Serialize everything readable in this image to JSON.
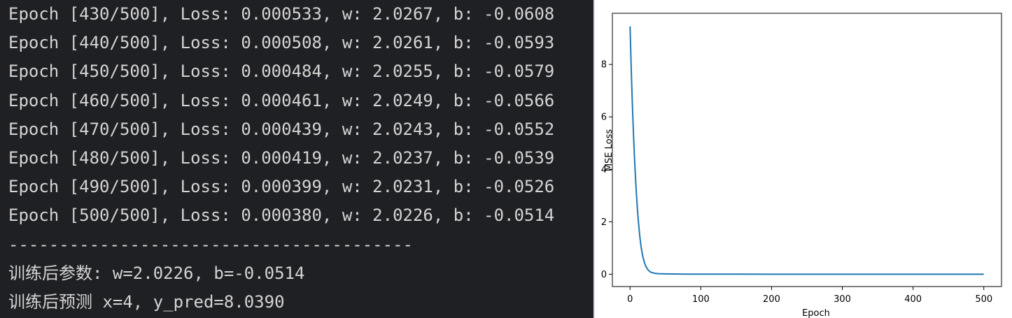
{
  "terminal": {
    "lines": [
      "Epoch [430/500], Loss: 0.000533, w: 2.0267, b: -0.0608",
      "Epoch [440/500], Loss: 0.000508, w: 2.0261, b: -0.0593",
      "Epoch [450/500], Loss: 0.000484, w: 2.0255, b: -0.0579",
      "Epoch [460/500], Loss: 0.000461, w: 2.0249, b: -0.0566",
      "Epoch [470/500], Loss: 0.000439, w: 2.0243, b: -0.0552",
      "Epoch [480/500], Loss: 0.000419, w: 2.0237, b: -0.0539",
      "Epoch [490/500], Loss: 0.000399, w: 2.0231, b: -0.0526",
      "Epoch [500/500], Loss: 0.000380, w: 2.0226, b: -0.0514",
      "----------------------------------------",
      "训练后参数: w=2.0226, b=-0.0514",
      "训练后预测 x=4, y_pred=8.0390"
    ],
    "text_color": "#d4d4d4",
    "background": "#1f2023"
  },
  "chart_data": {
    "type": "line",
    "xlabel": "Epoch",
    "ylabel": "MSE Loss",
    "xlim": [
      -25,
      525
    ],
    "ylim": [
      -0.47,
      9.95
    ],
    "xticks": [
      0,
      100,
      200,
      300,
      400,
      500
    ],
    "yticks": [
      0,
      2,
      4,
      6,
      8
    ],
    "grid": false,
    "line_color": "#1f77b4",
    "series": [
      {
        "x": [
          0,
          1,
          2,
          3,
          4,
          5,
          6,
          7,
          8,
          9,
          10,
          11,
          12,
          13,
          14,
          15,
          16,
          17,
          18,
          20,
          22,
          24,
          26,
          28,
          30,
          35,
          40,
          50,
          60,
          80,
          100,
          150,
          200,
          250,
          300,
          350,
          400,
          450,
          500
        ],
        "values": [
          9.45,
          8.45,
          7.52,
          6.68,
          5.92,
          5.22,
          4.6,
          4.03,
          3.52,
          3.06,
          2.64,
          2.27,
          1.94,
          1.65,
          1.39,
          1.17,
          0.98,
          0.82,
          0.68,
          0.47,
          0.32,
          0.22,
          0.15,
          0.1,
          0.07,
          0.035,
          0.02,
          0.012,
          0.008,
          0.0045,
          0.003,
          0.0015,
          0.001,
          0.0008,
          0.0006,
          0.0005,
          0.00045,
          0.0004,
          0.00038
        ]
      }
    ]
  }
}
